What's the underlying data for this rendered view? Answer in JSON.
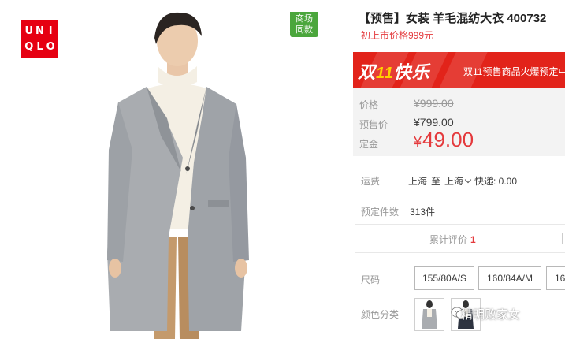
{
  "brand": {
    "logo_letters": [
      "U",
      "N",
      "I",
      "Q",
      "L",
      "O"
    ]
  },
  "photo": {
    "store_badge_line1": "商场",
    "store_badge_line2": "同款"
  },
  "product": {
    "title": "【预售】女装 羊毛混纺大衣 400732",
    "subtitle": "初上市价格999元"
  },
  "promo": {
    "logo_prefix": "双",
    "logo_eleven": "11",
    "logo_suffix": "快乐",
    "text": "双11预售商品火爆预定中"
  },
  "prices": {
    "list_label": "价格",
    "list_value": "¥999.00",
    "presale_label": "预售价",
    "presale_value": "¥799.00",
    "deposit_label": "定金",
    "deposit_currency": "¥",
    "deposit_value": "49.00"
  },
  "shipping": {
    "label": "运费",
    "from": "上海",
    "to_word": "至",
    "to": "上海",
    "express": "快递: 0.00"
  },
  "presale_count": {
    "label": "预定件数",
    "value": "313件"
  },
  "reviews": {
    "label": "累计评价",
    "count": "1"
  },
  "size": {
    "label": "尺码",
    "options": [
      "155/80A/S",
      "160/84A/M",
      "16"
    ]
  },
  "color": {
    "label": "颜色分类"
  },
  "watermark": {
    "text": "精明败家女"
  },
  "colors": {
    "accent": "#e4393c",
    "brand_red": "#e60012",
    "badge_green": "#4ba63c",
    "coat_grey": "#a9acb0"
  }
}
